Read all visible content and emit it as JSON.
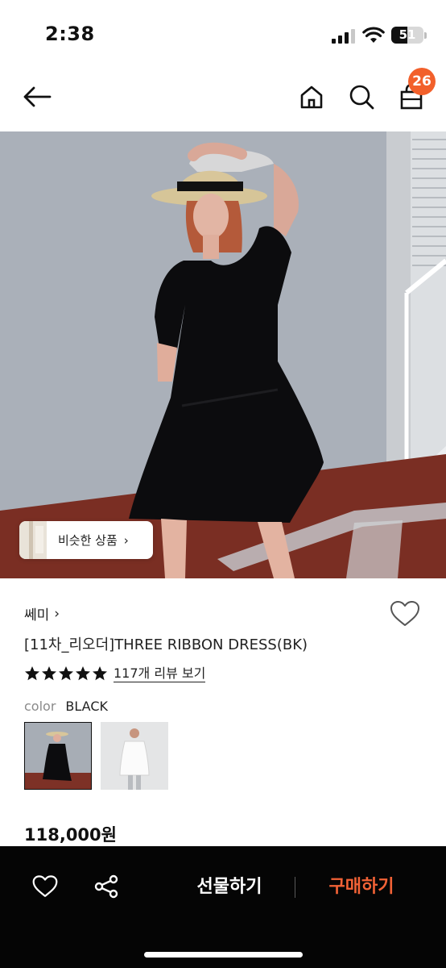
{
  "status_bar": {
    "time": "2:38",
    "battery_level": "51"
  },
  "nav": {
    "cart_badge_count": "26",
    "icons": [
      "back-arrow-icon",
      "home-icon",
      "search-icon",
      "cart-icon"
    ]
  },
  "hero": {
    "similar_label": "비슷한 상품",
    "similar_chevron": "›"
  },
  "product": {
    "brand": "쎄미",
    "brand_chevron": "›",
    "title": "[11차_리오더]THREE RIBBON DRESS(BK)",
    "rating_stars": 5,
    "review_link": "117개 리뷰 보기",
    "color_label": "color",
    "color_value": "BLACK",
    "price": "118,000원"
  },
  "bottom_bar": {
    "gift_label": "선물하기",
    "buy_label": "구매하기"
  },
  "colors": {
    "accent": "#f2602b",
    "buy": "#f26236",
    "bottom_bar_bg": "#050505"
  }
}
